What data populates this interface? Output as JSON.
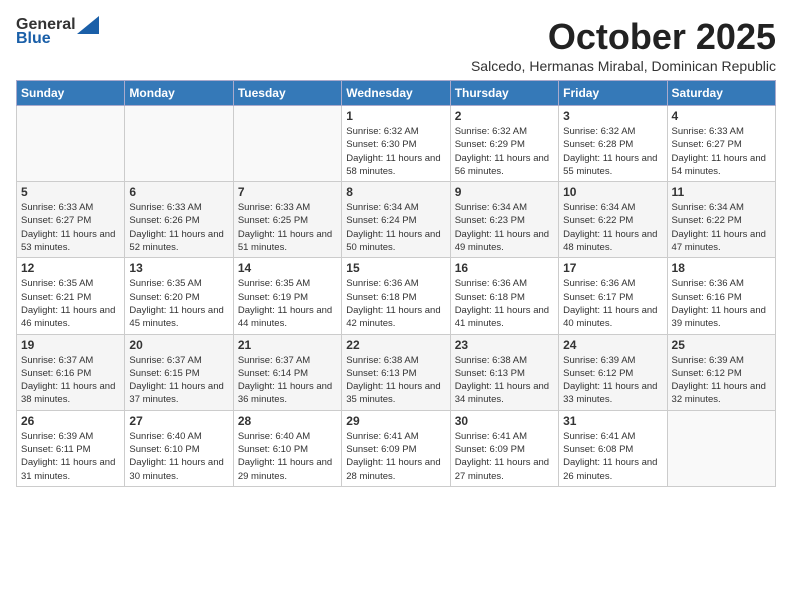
{
  "header": {
    "logo_top": "General",
    "logo_bottom": "Blue",
    "month": "October 2025",
    "location": "Salcedo, Hermanas Mirabal, Dominican Republic"
  },
  "days_of_week": [
    "Sunday",
    "Monday",
    "Tuesday",
    "Wednesday",
    "Thursday",
    "Friday",
    "Saturday"
  ],
  "weeks": [
    [
      {
        "day": "",
        "sunrise": "",
        "sunset": "",
        "daylight": ""
      },
      {
        "day": "",
        "sunrise": "",
        "sunset": "",
        "daylight": ""
      },
      {
        "day": "",
        "sunrise": "",
        "sunset": "",
        "daylight": ""
      },
      {
        "day": "1",
        "sunrise": "Sunrise: 6:32 AM",
        "sunset": "Sunset: 6:30 PM",
        "daylight": "Daylight: 11 hours and 58 minutes."
      },
      {
        "day": "2",
        "sunrise": "Sunrise: 6:32 AM",
        "sunset": "Sunset: 6:29 PM",
        "daylight": "Daylight: 11 hours and 56 minutes."
      },
      {
        "day": "3",
        "sunrise": "Sunrise: 6:32 AM",
        "sunset": "Sunset: 6:28 PM",
        "daylight": "Daylight: 11 hours and 55 minutes."
      },
      {
        "day": "4",
        "sunrise": "Sunrise: 6:33 AM",
        "sunset": "Sunset: 6:27 PM",
        "daylight": "Daylight: 11 hours and 54 minutes."
      }
    ],
    [
      {
        "day": "5",
        "sunrise": "Sunrise: 6:33 AM",
        "sunset": "Sunset: 6:27 PM",
        "daylight": "Daylight: 11 hours and 53 minutes."
      },
      {
        "day": "6",
        "sunrise": "Sunrise: 6:33 AM",
        "sunset": "Sunset: 6:26 PM",
        "daylight": "Daylight: 11 hours and 52 minutes."
      },
      {
        "day": "7",
        "sunrise": "Sunrise: 6:33 AM",
        "sunset": "Sunset: 6:25 PM",
        "daylight": "Daylight: 11 hours and 51 minutes."
      },
      {
        "day": "8",
        "sunrise": "Sunrise: 6:34 AM",
        "sunset": "Sunset: 6:24 PM",
        "daylight": "Daylight: 11 hours and 50 minutes."
      },
      {
        "day": "9",
        "sunrise": "Sunrise: 6:34 AM",
        "sunset": "Sunset: 6:23 PM",
        "daylight": "Daylight: 11 hours and 49 minutes."
      },
      {
        "day": "10",
        "sunrise": "Sunrise: 6:34 AM",
        "sunset": "Sunset: 6:22 PM",
        "daylight": "Daylight: 11 hours and 48 minutes."
      },
      {
        "day": "11",
        "sunrise": "Sunrise: 6:34 AM",
        "sunset": "Sunset: 6:22 PM",
        "daylight": "Daylight: 11 hours and 47 minutes."
      }
    ],
    [
      {
        "day": "12",
        "sunrise": "Sunrise: 6:35 AM",
        "sunset": "Sunset: 6:21 PM",
        "daylight": "Daylight: 11 hours and 46 minutes."
      },
      {
        "day": "13",
        "sunrise": "Sunrise: 6:35 AM",
        "sunset": "Sunset: 6:20 PM",
        "daylight": "Daylight: 11 hours and 45 minutes."
      },
      {
        "day": "14",
        "sunrise": "Sunrise: 6:35 AM",
        "sunset": "Sunset: 6:19 PM",
        "daylight": "Daylight: 11 hours and 44 minutes."
      },
      {
        "day": "15",
        "sunrise": "Sunrise: 6:36 AM",
        "sunset": "Sunset: 6:18 PM",
        "daylight": "Daylight: 11 hours and 42 minutes."
      },
      {
        "day": "16",
        "sunrise": "Sunrise: 6:36 AM",
        "sunset": "Sunset: 6:18 PM",
        "daylight": "Daylight: 11 hours and 41 minutes."
      },
      {
        "day": "17",
        "sunrise": "Sunrise: 6:36 AM",
        "sunset": "Sunset: 6:17 PM",
        "daylight": "Daylight: 11 hours and 40 minutes."
      },
      {
        "day": "18",
        "sunrise": "Sunrise: 6:36 AM",
        "sunset": "Sunset: 6:16 PM",
        "daylight": "Daylight: 11 hours and 39 minutes."
      }
    ],
    [
      {
        "day": "19",
        "sunrise": "Sunrise: 6:37 AM",
        "sunset": "Sunset: 6:16 PM",
        "daylight": "Daylight: 11 hours and 38 minutes."
      },
      {
        "day": "20",
        "sunrise": "Sunrise: 6:37 AM",
        "sunset": "Sunset: 6:15 PM",
        "daylight": "Daylight: 11 hours and 37 minutes."
      },
      {
        "day": "21",
        "sunrise": "Sunrise: 6:37 AM",
        "sunset": "Sunset: 6:14 PM",
        "daylight": "Daylight: 11 hours and 36 minutes."
      },
      {
        "day": "22",
        "sunrise": "Sunrise: 6:38 AM",
        "sunset": "Sunset: 6:13 PM",
        "daylight": "Daylight: 11 hours and 35 minutes."
      },
      {
        "day": "23",
        "sunrise": "Sunrise: 6:38 AM",
        "sunset": "Sunset: 6:13 PM",
        "daylight": "Daylight: 11 hours and 34 minutes."
      },
      {
        "day": "24",
        "sunrise": "Sunrise: 6:39 AM",
        "sunset": "Sunset: 6:12 PM",
        "daylight": "Daylight: 11 hours and 33 minutes."
      },
      {
        "day": "25",
        "sunrise": "Sunrise: 6:39 AM",
        "sunset": "Sunset: 6:12 PM",
        "daylight": "Daylight: 11 hours and 32 minutes."
      }
    ],
    [
      {
        "day": "26",
        "sunrise": "Sunrise: 6:39 AM",
        "sunset": "Sunset: 6:11 PM",
        "daylight": "Daylight: 11 hours and 31 minutes."
      },
      {
        "day": "27",
        "sunrise": "Sunrise: 6:40 AM",
        "sunset": "Sunset: 6:10 PM",
        "daylight": "Daylight: 11 hours and 30 minutes."
      },
      {
        "day": "28",
        "sunrise": "Sunrise: 6:40 AM",
        "sunset": "Sunset: 6:10 PM",
        "daylight": "Daylight: 11 hours and 29 minutes."
      },
      {
        "day": "29",
        "sunrise": "Sunrise: 6:41 AM",
        "sunset": "Sunset: 6:09 PM",
        "daylight": "Daylight: 11 hours and 28 minutes."
      },
      {
        "day": "30",
        "sunrise": "Sunrise: 6:41 AM",
        "sunset": "Sunset: 6:09 PM",
        "daylight": "Daylight: 11 hours and 27 minutes."
      },
      {
        "day": "31",
        "sunrise": "Sunrise: 6:41 AM",
        "sunset": "Sunset: 6:08 PM",
        "daylight": "Daylight: 11 hours and 26 minutes."
      },
      {
        "day": "",
        "sunrise": "",
        "sunset": "",
        "daylight": ""
      }
    ]
  ]
}
